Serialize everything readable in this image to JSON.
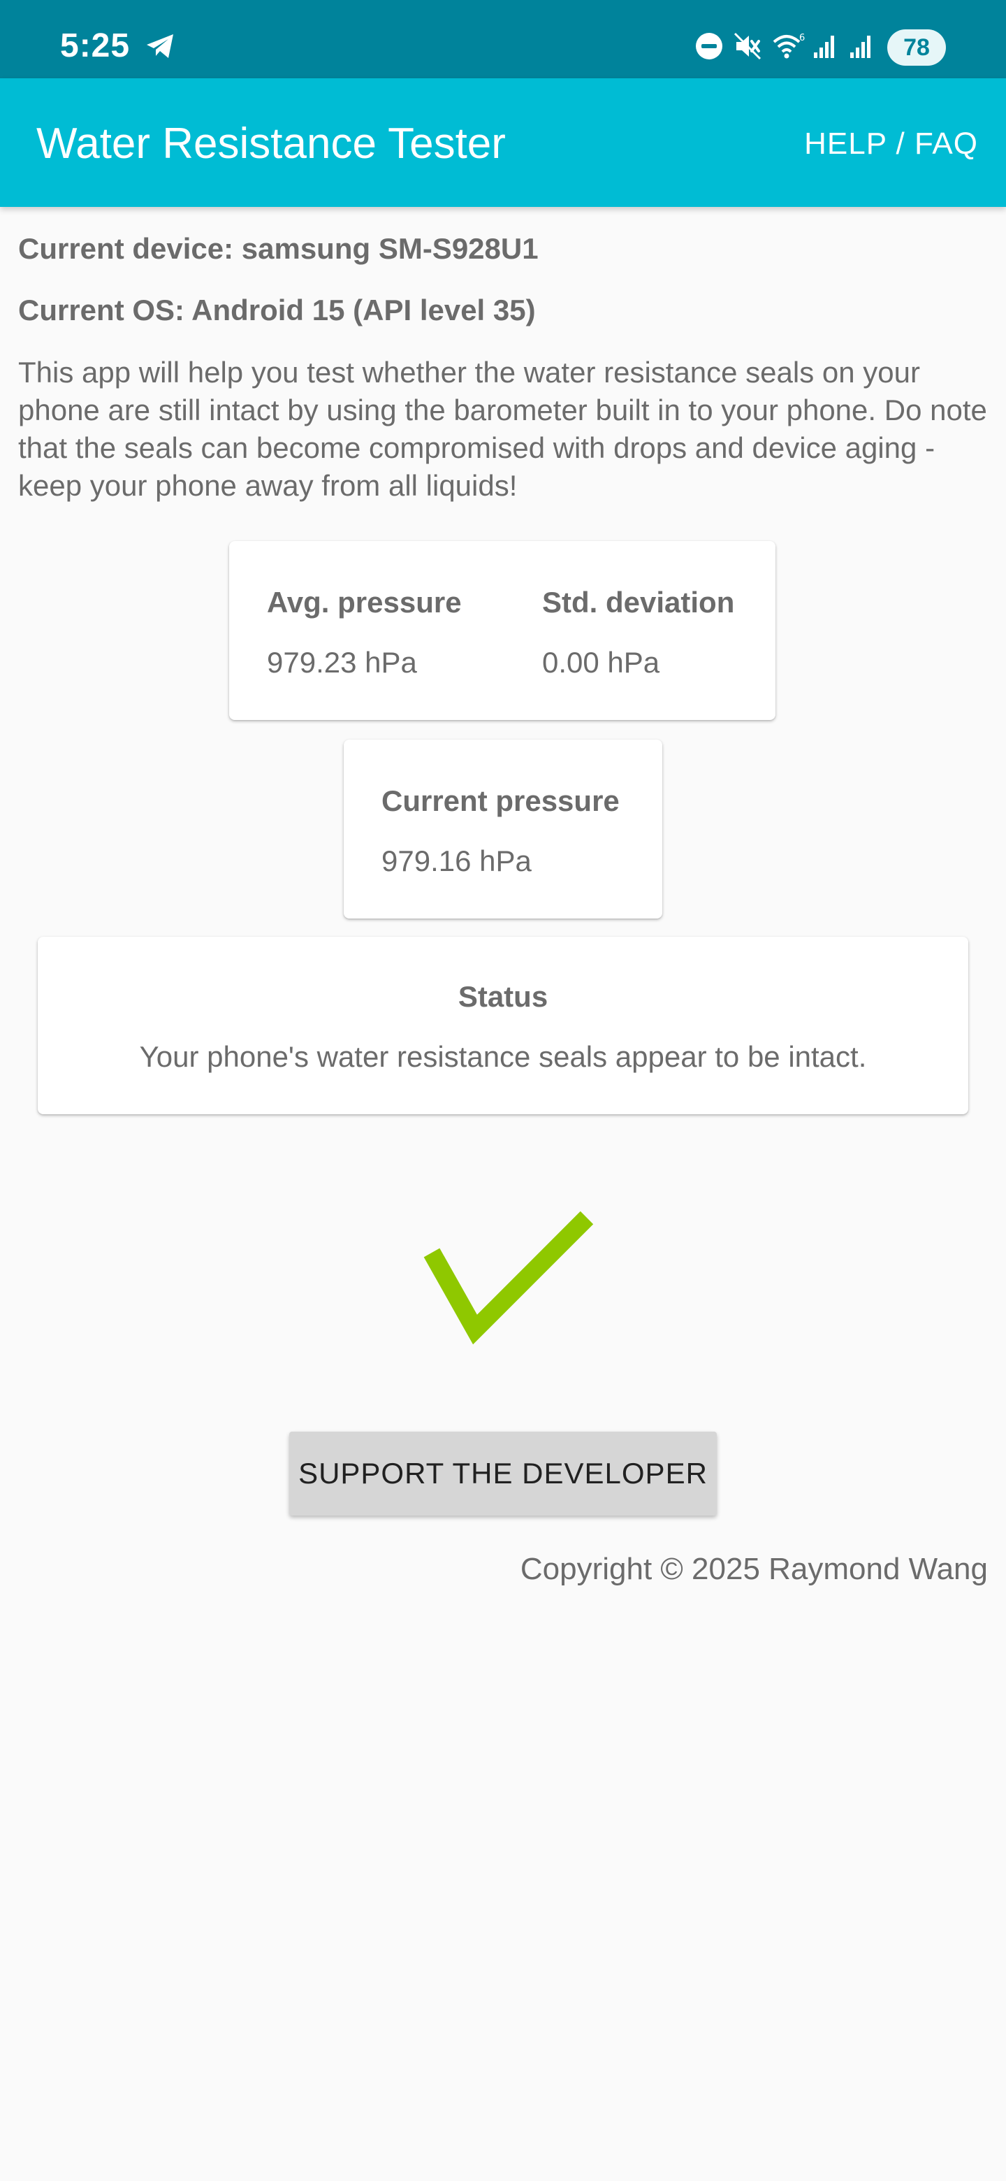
{
  "status_bar": {
    "time": "5:25",
    "battery": "78",
    "icons": [
      "telegram-icon",
      "do-not-disturb-icon",
      "muted-icon",
      "wifi-6-icon",
      "signal-icon",
      "signal-icon"
    ]
  },
  "app_bar": {
    "title": "Water Resistance Tester",
    "help_label": "HELP / FAQ"
  },
  "device_info": {
    "device": "Current device: samsung SM-S928U1",
    "os": "Current OS: Android 15 (API level 35)"
  },
  "description": "This app will help you test whether the water resistance seals on your phone are still intact by using the barometer built in to your phone. Do note that the seals can become compromised with drops and device aging - keep your phone away from all liquids!",
  "stats": {
    "avg_label": "Avg. pressure",
    "avg_value": "979.23 hPa",
    "std_label": "Std. deviation",
    "std_value": "0.00 hPa"
  },
  "current": {
    "label": "Current pressure",
    "value": "979.16 hPa"
  },
  "status": {
    "title": "Status",
    "message": "Your phone's water resistance seals appear to be intact.",
    "icon": "checkmark-icon"
  },
  "support_button_label": "SUPPORT THE DEVELOPER",
  "copyright": "Copyright © 2025 Raymond Wang",
  "colors": {
    "status_bar": "#00839b",
    "app_bar": "#00bcd4",
    "check": "#8fc800",
    "background": "#fafafa",
    "button": "#d6d6d6"
  }
}
